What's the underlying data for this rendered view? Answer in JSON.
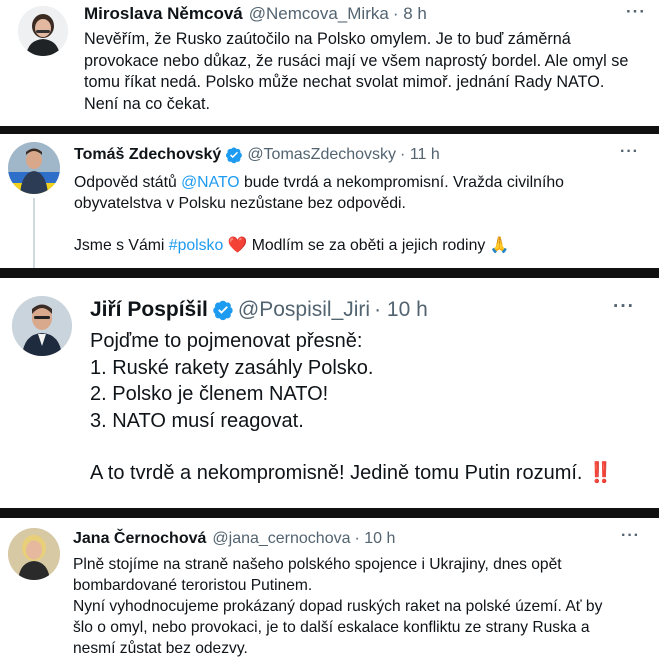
{
  "tweets": [
    {
      "name": "Miroslava Němcová",
      "handle": "@Nemcova_Mirka",
      "time": "· 8 h",
      "more": "···",
      "lines": [
        "Nevěřím, že Rusko zaútočilo na Polsko omylem. Je to buď záměrná",
        "provokace nebo důkaz, že rusáci mají ve všem naprostý bordel. Ale omyl se",
        "tomu říkat nedá. Polsko může nechat svolat mimoř. jednání Rady NATO.",
        "Není na co čekat."
      ]
    },
    {
      "name": "Tomáš Zdechovský",
      "handle": "@TomasZdechovsky",
      "time": "· 11 h",
      "more": "···",
      "line1_a": "Odpověd států ",
      "line1_link": "@NATO",
      "line1_b": " bude tvrdá a nekompromisní. Vražda civilního",
      "line2": "obyvatelstva v Polsku nezůstane bez odpovědi.",
      "line3_a": "Jsme s Vámi ",
      "line3_link": "#polsko",
      "line3_heart": "❤️",
      "line3_b": " Modlím se za oběti a jejich rodiny ",
      "line3_emoji": "🙏"
    },
    {
      "name": "Jiří Pospíšil",
      "handle": "@Pospisil_Jiri",
      "time": "· 10 h",
      "more": "···",
      "lines": [
        "Pojďme to pojmenovat přesně:",
        "1. Ruské rakety zasáhly Polsko.",
        "2. Polsko je členem NATO!",
        "3. NATO musí reagovat."
      ],
      "last_line": "A to tvrdě a nekompromisně! Jedině tomu Putin rozumí.",
      "last_emoji": "‼️"
    },
    {
      "name": "Jana Černochová",
      "handle": "@jana_cernochova",
      "time": "· 10 h",
      "more": "···",
      "lines": [
        "Plně stojíme na straně našeho polského spojence i Ukrajiny, dnes opět",
        "bombardované teroristou Putinem.",
        "Nyní vyhodnocujeme prokázaný dopad ruských raket na polské území. Ať by",
        "šlo o omyl, nebo provokaci, je to další eskalace konfliktu ze strany Ruska a",
        "nesmí zůstat bez odezvy."
      ]
    }
  ],
  "colors": {
    "link": "#1d9bf0",
    "verified": "#1d9bf0",
    "secondary_text": "#536471",
    "separator": "#111111"
  }
}
